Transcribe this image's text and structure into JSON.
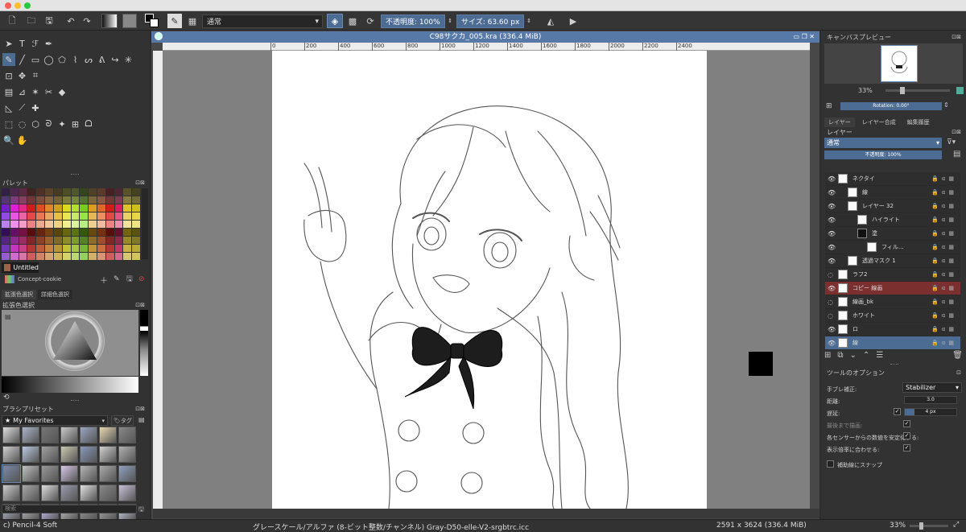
{
  "toolbar": {
    "blend_mode": "通常",
    "opacity_label": "不透明度: 100%",
    "size_label": "サイズ: 63.60 px"
  },
  "document": {
    "title": "C98サクカ_005.kra (336.4 MiB)",
    "ruler_ticks": [
      "0",
      "200",
      "400",
      "600",
      "800",
      "1000",
      "1200",
      "1400",
      "1600",
      "1800",
      "2000",
      "2200",
      "2400"
    ]
  },
  "left_panel": {
    "palette_title": "パレット",
    "palette_name": "Untitled",
    "palette_preset": "Concept-cookie",
    "color_tabs": [
      "拡張色選択",
      "詳細色選択"
    ],
    "color_selector_title": "拡張色選択",
    "brush_presets_title": "ブラシプリセット",
    "brush_tag_dropdown": "My Favorites",
    "brush_tag_button": "タグ",
    "search_placeholder": "検索"
  },
  "right_panel": {
    "canvas_preview_title": "キャンバスプレビュー",
    "zoom_label": "33%",
    "rotation_label": "Rotation: 0.00°",
    "tabs": [
      "レイヤー",
      "レイヤー合成",
      "編集履歴"
    ],
    "layers_title": "レイヤー",
    "layer_blend_mode": "通常",
    "layer_opacity": "不透明度: 100%",
    "layers": [
      {
        "name": "ネクタイ",
        "indent": 0,
        "selected": false,
        "dark_thumb": false
      },
      {
        "name": "線",
        "indent": 1,
        "selected": false,
        "dark_thumb": false
      },
      {
        "name": "レイヤー 32",
        "indent": 1,
        "selected": false,
        "dark_thumb": false
      },
      {
        "name": "ハイライト",
        "indent": 2,
        "selected": false,
        "dark_thumb": false
      },
      {
        "name": "塗",
        "indent": 2,
        "selected": false,
        "dark_thumb": true
      },
      {
        "name": "フィル...",
        "indent": 3,
        "selected": false,
        "dark_thumb": false
      },
      {
        "name": "透過マスク 1",
        "indent": 1,
        "selected": false,
        "dark_thumb": false
      },
      {
        "name": "ラフ2",
        "indent": 0,
        "selected": false,
        "dark_thumb": false
      },
      {
        "name": "コピー 線画",
        "indent": 0,
        "selected": "red",
        "dark_thumb": false
      },
      {
        "name": "線画_bk",
        "indent": 0,
        "selected": false,
        "dark_thumb": false
      },
      {
        "name": "ホワイト",
        "indent": 0,
        "selected": false,
        "dark_thumb": false
      },
      {
        "name": "ロ",
        "indent": 0,
        "selected": false,
        "dark_thumb": false
      },
      {
        "name": "線",
        "indent": 0,
        "selected": "blue",
        "dark_thumb": false
      }
    ],
    "tool_options_title": "ツールのオプション",
    "smoothing_label": "手ブレ補正:",
    "smoothing_value": "Stabilizer",
    "distance_label": "距離:",
    "distance_value": "3.0",
    "delay_label": "遅延:",
    "delay_value": "4 px",
    "option_finish": "最後まで描画:",
    "option_stabilize": "各センサーからの数値を安定化する:",
    "option_scale": "表示倍率に合わせる:",
    "snap_label": "補助線にスナップ"
  },
  "status": {
    "brush_name": "c) Pencil-4 Soft",
    "color_profile": "グレースケール/アルファ (8-ビット整数/チャンネル)  Gray-D50-elle-V2-srgbtrc.icc",
    "image_size": "2591 x 3624 (336.4 MiB)",
    "zoom": "33%"
  },
  "colors": {
    "accent": "#5679a8",
    "selected_red": "#7b2f2f",
    "selected_blue": "#4d6c93"
  }
}
